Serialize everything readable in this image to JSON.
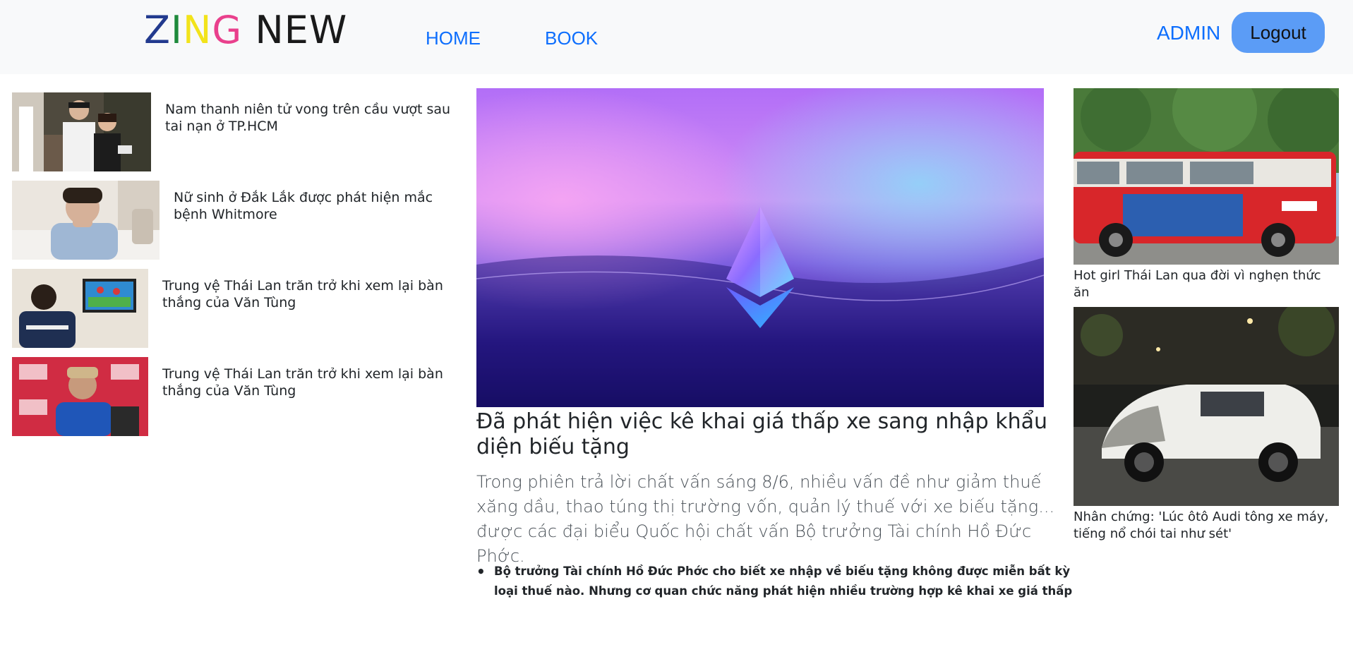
{
  "header": {
    "logo_parts": [
      {
        "text": "Z",
        "color": "#223a8e"
      },
      {
        "text": "I",
        "color": "#1e8a3b"
      },
      {
        "text": "N",
        "color": "#f2e31b"
      },
      {
        "text": "G",
        "color": "#e9408c"
      },
      {
        "text": " NEW",
        "color": "#1a1a1a"
      }
    ],
    "nav": [
      {
        "label": "HOME"
      },
      {
        "label": "BOOK"
      }
    ],
    "admin_label": "ADMIN",
    "logout_label": "Logout"
  },
  "left_articles": [
    {
      "title": "Nam thanh niên tử vong trên cầu vượt sau tai nạn ở TP.HCM",
      "image": "couple-photo"
    },
    {
      "title": "Nữ sinh ở Đắk Lắk được phát hiện mắc bệnh Whitmore",
      "image": "student-photo"
    },
    {
      "title": "Trung vệ Thái Lan trăn trở khi xem lại bàn thắng của Văn Tùng",
      "image": "player-tv-photo"
    },
    {
      "title": "Trung vệ Thái Lan trăn trở khi xem lại bàn thắng của Văn Tùng",
      "image": "player-press-photo"
    }
  ],
  "main_article": {
    "image": "ethereum-logo-gradient",
    "title": "Đã phát hiện việc kê khai giá thấp xe sang nhập khẩu diện biếu tặng",
    "lead": "Trong phiên trả lời chất vấn sáng 8/6, nhiều vấn đề như giảm thuế xăng dầu, thao túng thị trường vốn, quản lý thuế với xe biếu tặng... được các đại biểu Quốc hội chất vấn Bộ trưởng Tài chính Hồ Đức Phớc.",
    "bullets": [
      "Bộ trưởng Tài chính Hồ Đức Phớc cho biết xe nhập về biếu tặng không được miễn bất kỳ loại thuế nào. Nhưng cơ quan chức năng phát hiện nhiều trường hợp kê khai xe giá thấp"
    ]
  },
  "right_articles": [
    {
      "title": "Hot girl Thái Lan qua đời vì nghẹn thức ăn",
      "image": "red-bus-photo"
    },
    {
      "title": "Nhân chứng: 'Lúc ôtô Audi tông xe máy, tiếng nổ chói tai như sét'",
      "image": "crashed-audi-photo"
    }
  ],
  "colors": {
    "nav_link": "#0d6efd",
    "logout_bg": "#5b9cf6",
    "header_bg": "#f8f9fa"
  }
}
